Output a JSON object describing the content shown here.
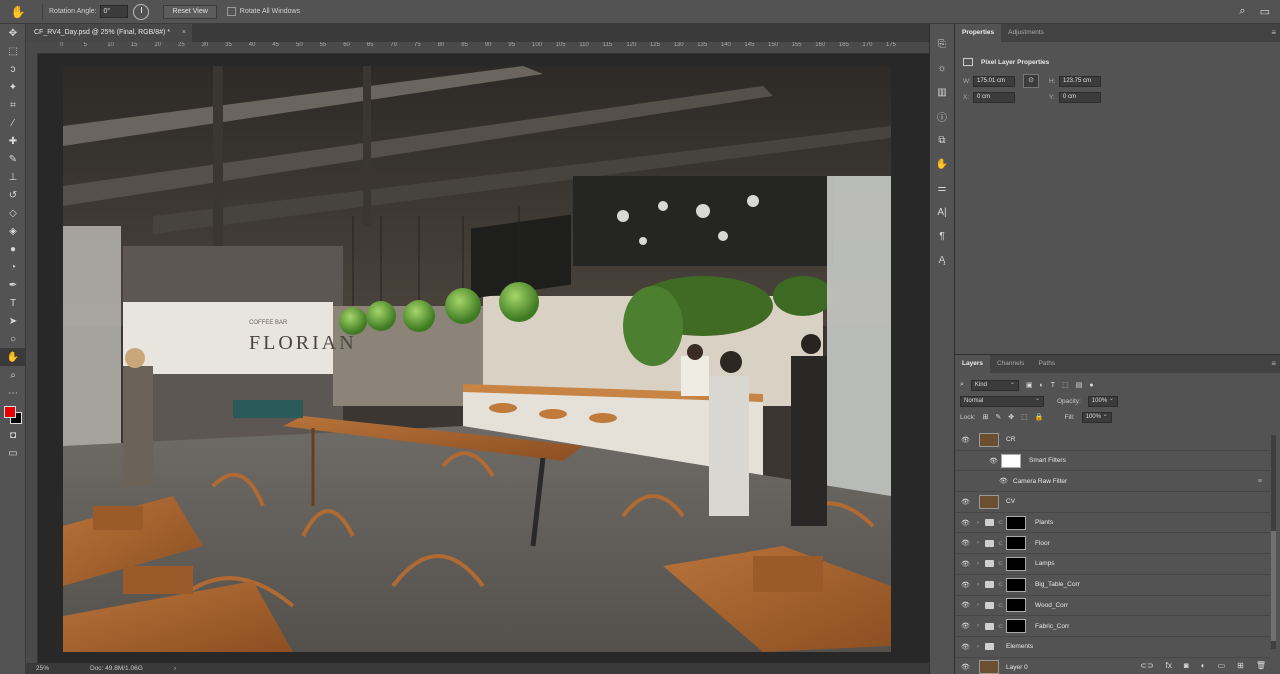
{
  "optionsBar": {
    "tool_icon": "hand-rotate-icon",
    "rotation_label": "Rotation Angle:",
    "rotation_value": "0°",
    "reset_view": "Reset View",
    "rotate_all": "Rotate All Windows"
  },
  "document": {
    "tab_title": "CF_RV4_Day.psd @ 25% (Final, RGB/8#) *",
    "zoom": "25%",
    "doc_size": "Doc: 49.8M/1.06G",
    "ruler_ticks": [
      "0",
      "5",
      "10",
      "15",
      "20",
      "25",
      "30",
      "35",
      "40",
      "45",
      "50",
      "55",
      "60",
      "65",
      "70",
      "75",
      "80",
      "85",
      "90",
      "95",
      "100",
      "105",
      "110",
      "115",
      "120",
      "125",
      "130",
      "135",
      "140",
      "145",
      "150",
      "155",
      "160",
      "165",
      "170",
      "175"
    ],
    "scene_sign": "FLORIAN",
    "scene_sign_small": "COFFEE BAR"
  },
  "colors": {
    "foreground": "#e60000",
    "background": "#000000"
  },
  "properties": {
    "tabs": [
      "Properties",
      "Adjustments"
    ],
    "header": "Pixel Layer Properties",
    "w_label": "W:",
    "w_value": "175.01 cm",
    "h_label": "H:",
    "h_value": "123.75 cm",
    "x_label": "X:",
    "x_value": "0 cm",
    "y_label": "Y:",
    "y_value": "0 cm"
  },
  "layersPanel": {
    "tabs": [
      "Layers",
      "Channels",
      "Paths"
    ],
    "filter_kind": "Kind",
    "blend_mode": "Normal",
    "opacity_label": "Opacity:",
    "opacity_value": "100%",
    "lock_label": "Lock:",
    "fill_label": "Fill:",
    "fill_value": "100%",
    "layers": [
      {
        "name": "CR",
        "kind": "smart"
      },
      {
        "name": "Smart Filters",
        "kind": "filters"
      },
      {
        "name": "Camera Raw Filter",
        "kind": "filter"
      },
      {
        "name": "CV",
        "kind": "image"
      },
      {
        "name": "Plants",
        "kind": "group"
      },
      {
        "name": "Floor",
        "kind": "group"
      },
      {
        "name": "Lamps",
        "kind": "group"
      },
      {
        "name": "Big_Table_Corr",
        "kind": "group"
      },
      {
        "name": "Wood_Corr",
        "kind": "group"
      },
      {
        "name": "Fabric_Corr",
        "kind": "group"
      },
      {
        "name": "Elements",
        "kind": "group-nomask"
      },
      {
        "name": "Layer 0",
        "kind": "image"
      }
    ]
  }
}
